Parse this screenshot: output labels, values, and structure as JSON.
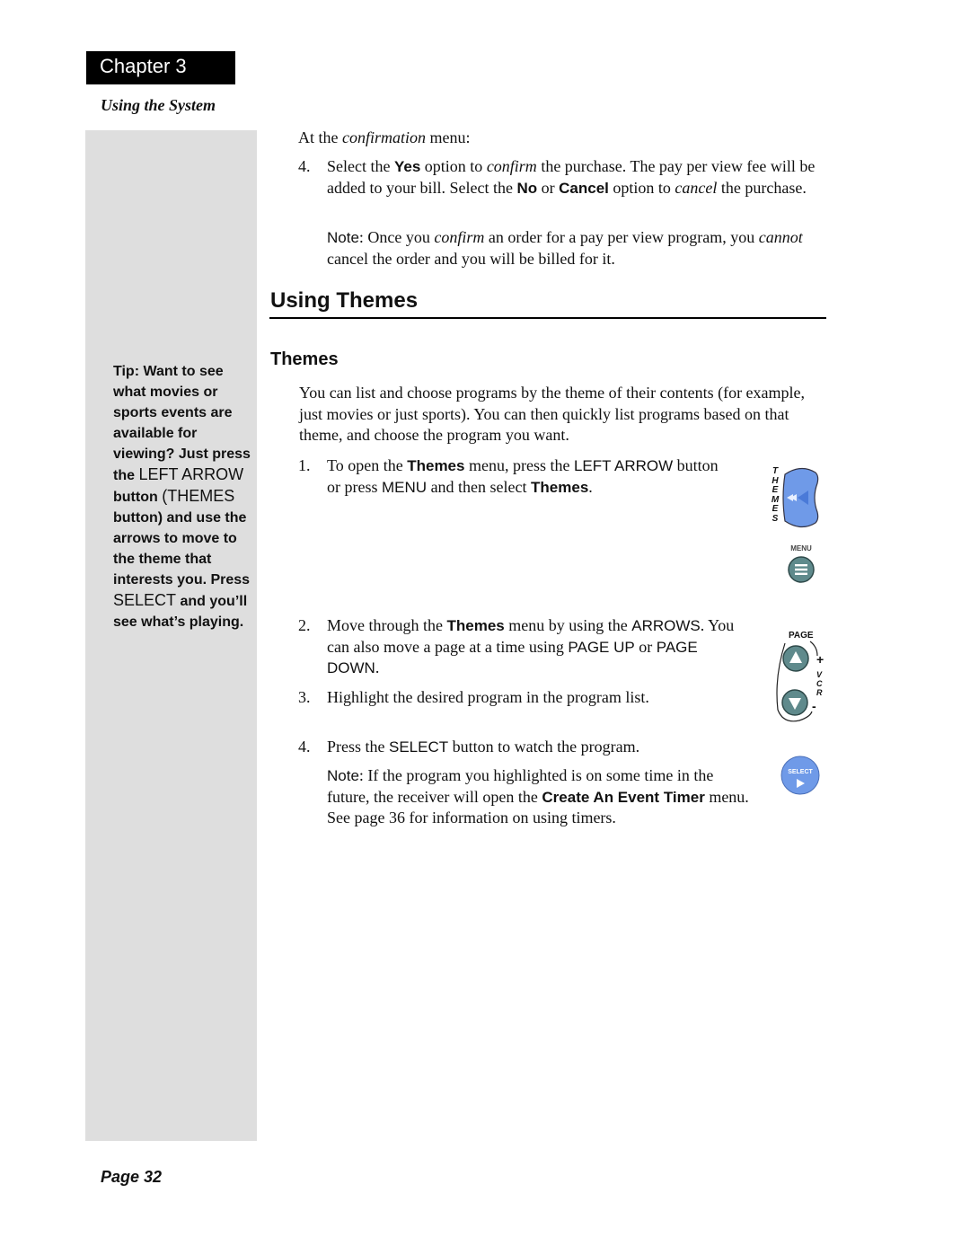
{
  "header": {
    "chapter": "Chapter 3",
    "section": "Using the System"
  },
  "sidebar": {
    "tip_parts": [
      "Tip: Want to see what movies or sports events are available for viewing? Just press the ",
      "LEFT ARROW",
      " button ",
      "(THEMES",
      " button) and use the arrows to move to the theme that interests you. Press ",
      "SELECT",
      " and you’ll see what’s playing."
    ]
  },
  "confirmation": {
    "intro_a": "At the ",
    "intro_em": "confirmation",
    "intro_b": " menu:",
    "step": {
      "num": "4.",
      "t1": "Select the ",
      "yes": "Yes",
      "t2": " option to ",
      "confirm_em": "confirm",
      "t3": " the purchase. The pay per view fee will be added to your bill. Select the ",
      "no": "No",
      "t4": " or ",
      "cancel": "Cancel",
      "t5": " option to ",
      "cancel_em": "cancel",
      "t6": " the purchase."
    },
    "note": {
      "label": "Note",
      "t1": ": Once you ",
      "confirm_em": "confirm",
      "t2": " an order for a pay per view program, you ",
      "cannot_em": "cannot",
      "t3": " cancel the order and you will be billed for it."
    }
  },
  "section": {
    "title": "Using Themes",
    "subtitle": "Themes",
    "intro": "You can list and choose programs by the theme of their contents (for example, just movies or just sports). You can then quickly list programs based on that theme, and choose the program you want."
  },
  "steps": [
    {
      "num": "1.",
      "parts": [
        "To open the ",
        "Themes",
        " menu, press the ",
        "LEFT ARROW",
        " button or press ",
        "MENU",
        " and then select ",
        "Themes",
        "."
      ]
    },
    {
      "num": "2.",
      "parts": [
        "Move through the ",
        "Themes",
        " menu by using the ",
        "ARROWS",
        ". You can also move a page at a time using ",
        "PAGE UP",
        " or ",
        "PAGE DOWN",
        "."
      ]
    },
    {
      "num": "3.",
      "text": "Highlight the desired program in the program list."
    },
    {
      "num": "4.",
      "parts": [
        "Press the ",
        "SELECT",
        " button to watch the program."
      ]
    }
  ],
  "final_note": {
    "label": "Note",
    "t1": ": If the program you highlighted is on some time in the future, the receiver will open the ",
    "menu": "Create An Event Timer",
    "t2": " menu. See page 36 for information on using timers."
  },
  "icons": {
    "themes_label": "THEMES",
    "menu_label": "MENU",
    "page_label": "PAGE",
    "vcr_label": "VCR",
    "plus": "+",
    "minus": "-",
    "select_label": "SELECT",
    "blue": "#6f9ae8",
    "teal": "#5f8a8c"
  },
  "footer": {
    "page": "Page 32"
  }
}
